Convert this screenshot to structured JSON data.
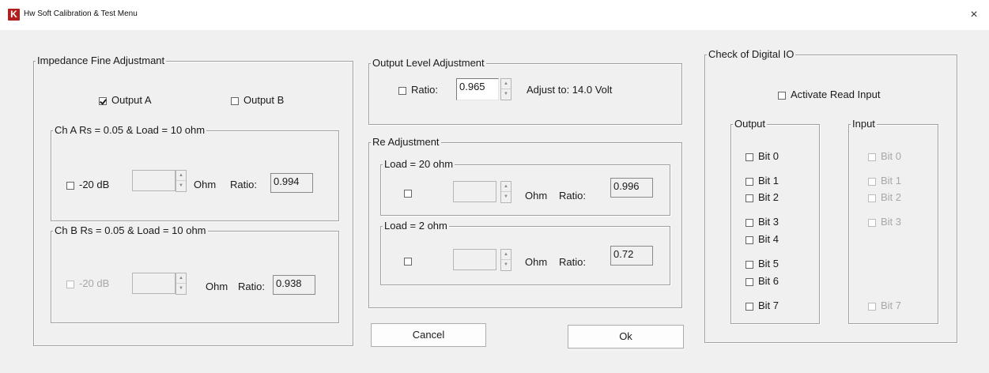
{
  "window": {
    "title": "Hw Soft Calibration & Test Menu",
    "close_glyph": "×",
    "logo_text": "K"
  },
  "impedance": {
    "title": "Impedance Fine Adjustmant",
    "output_a": {
      "label": "Output A",
      "checked": true
    },
    "output_b": {
      "label": "Output B",
      "checked": false
    },
    "ch_a": {
      "title": "Ch A   Rs = 0.05 & Load = 10 ohm",
      "db_label": "-20 dB",
      "ohm_label": "Ohm",
      "ratio_label": "Ratio:",
      "ratio_value": "0.994"
    },
    "ch_b": {
      "title": "Ch B   Rs = 0.05 & Load = 10 ohm",
      "db_label": "-20 dB",
      "ohm_label": "Ohm",
      "ratio_label": "Ratio:",
      "ratio_value": "0.938"
    }
  },
  "output_level": {
    "title": "Output Level Adjustment",
    "ratio_label": "Ratio:",
    "ratio_value": "0.965",
    "adjust_text": "Adjust to:  14.0 Volt"
  },
  "re_adjustment": {
    "title": "Re Adjustment",
    "load20": {
      "title": "Load = 20 ohm",
      "ohm_label": "Ohm",
      "ratio_label": "Ratio:",
      "ratio_value": "0.996"
    },
    "load2": {
      "title": "Load = 2 ohm",
      "ohm_label": "Ohm",
      "ratio_label": "Ratio:",
      "ratio_value": "0.72"
    }
  },
  "buttons": {
    "cancel": "Cancel",
    "ok": "Ok"
  },
  "digital_io": {
    "title": "Check of Digital IO",
    "activate_label": "Activate Read Input",
    "output_title": "Output",
    "input_title": "Input",
    "output_bits": [
      "Bit 0",
      "Bit 1",
      "Bit 2",
      "Bit 3",
      "Bit 4",
      "Bit 5",
      "Bit 6",
      "Bit 7"
    ],
    "input_bits": [
      "Bit 0",
      "Bit 1",
      "Bit 2",
      "Bit 3",
      "Bit 7"
    ]
  }
}
